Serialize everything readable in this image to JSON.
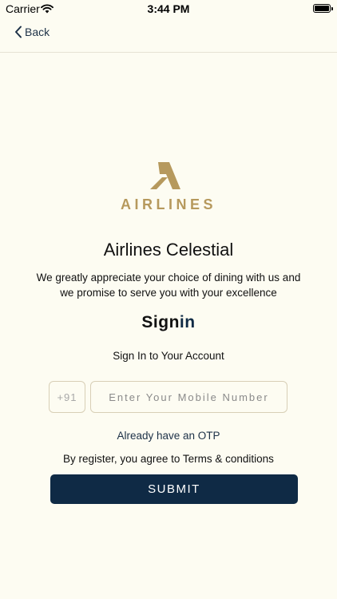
{
  "status_bar": {
    "carrier": "Carrier",
    "time": "3:44 PM"
  },
  "nav": {
    "back_label": "Back"
  },
  "logo": {
    "wordmark": "AIRLINES",
    "color": "#b6995d"
  },
  "app_title": "Airlines Celestial",
  "tagline": "We greatly appreciate your choice of dining with us and we promise to serve you with your excellence",
  "signin": {
    "heading_part1": "Sign",
    "heading_part2": "in",
    "subheading": "Sign In to Your Account",
    "country_code": "+91",
    "mobile_placeholder": "Enter Your Mobile Number",
    "otp_link": "Already have an OTP",
    "terms": "By register, you agree to Terms & conditions",
    "submit_label": "SUBMIT"
  },
  "colors": {
    "background": "#fdfcf2",
    "accent": "#0f2a45",
    "gold": "#b6995d"
  }
}
